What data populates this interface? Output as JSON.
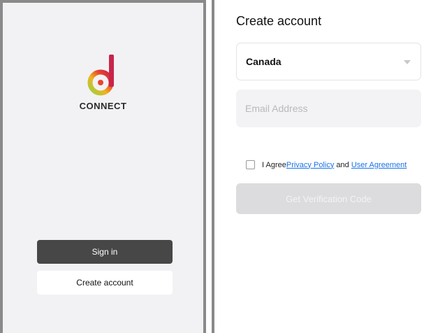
{
  "left": {
    "logo_text": "CONNECT",
    "signin_label": "Sign in",
    "create_label": "Create account"
  },
  "right": {
    "title": "Create account",
    "country": "Canada",
    "email_placeholder": "Email Address",
    "agree_prefix": "I Agree",
    "privacy_policy": "Privacy Policy",
    "and_text": "and",
    "user_agreement": "User Agreement",
    "verify_label": "Get Verification Code"
  },
  "colors": {
    "accent_link": "#1a73e8",
    "dark_button": "#474747",
    "disabled_button": "#dcdcde"
  }
}
